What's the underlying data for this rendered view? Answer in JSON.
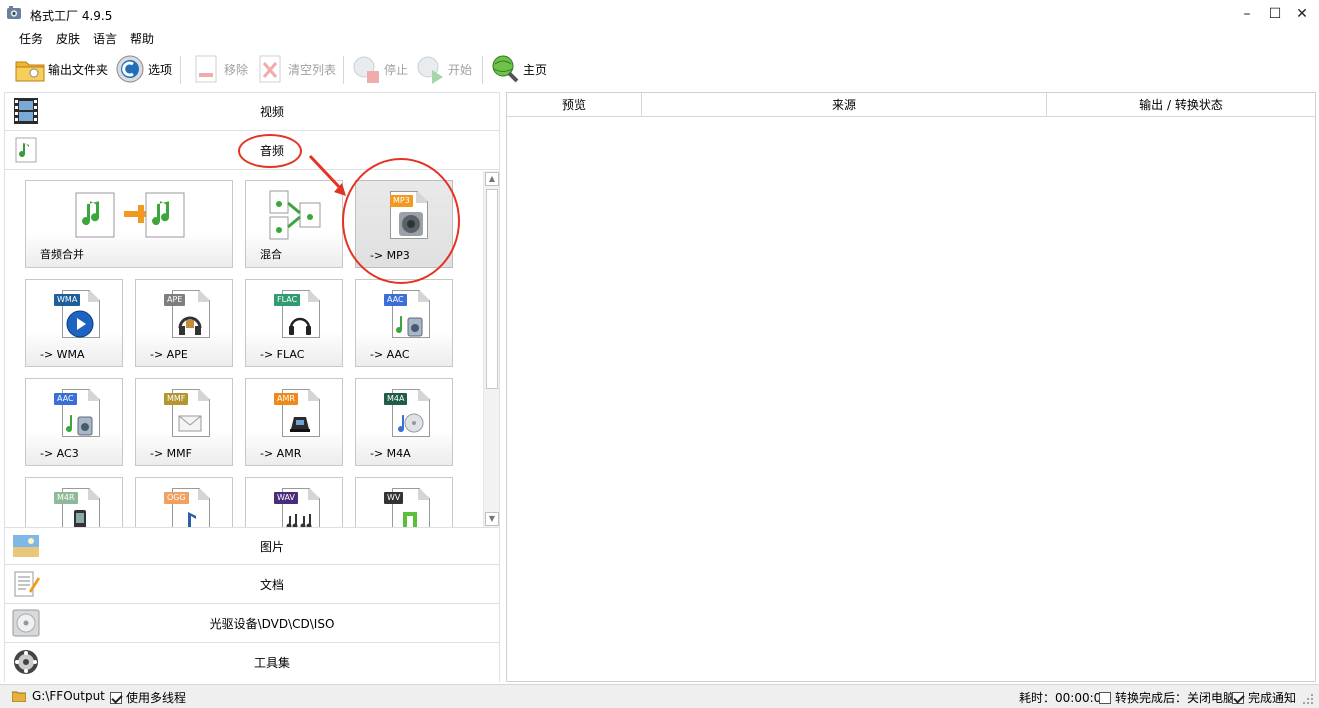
{
  "window": {
    "title": "格式工厂 4.9.5",
    "minimize": "–",
    "maximize": "☐",
    "close": "✕"
  },
  "menu": [
    "任务",
    "皮肤",
    "语言",
    "帮助"
  ],
  "toolbar": {
    "output_folder": "输出文件夹",
    "options": "选项",
    "remove": "移除",
    "clear_list": "清空列表",
    "stop": "停止",
    "start": "开始",
    "home": "主页"
  },
  "categories": {
    "video": "视频",
    "audio": "音频",
    "image": "图片",
    "document": "文档",
    "disc": "光驱设备\\DVD\\CD\\ISO",
    "tools": "工具集"
  },
  "audio_tiles": [
    {
      "label": "音频合并",
      "icon": "audio-merge-icon"
    },
    {
      "label": "混合",
      "icon": "audio-mix-icon"
    },
    {
      "label": "-> MP3",
      "badge": "MP3",
      "badge_color": "#f29a1f",
      "icon": "speaker-icon"
    },
    {
      "label": "-> WMA",
      "badge": "WMA",
      "badge_color": "#1d5f99",
      "icon": "play-icon"
    },
    {
      "label": "-> APE",
      "badge": "APE",
      "badge_color": "#7e7e7e",
      "icon": "headphones-icon"
    },
    {
      "label": "-> FLAC",
      "badge": "FLAC",
      "badge_color": "#2f9b6f",
      "icon": "headset-icon"
    },
    {
      "label": "-> AAC",
      "badge": "AAC",
      "badge_color": "#3a6fd8",
      "icon": "music-speaker-icon"
    },
    {
      "label": "-> AC3",
      "badge": "AAC",
      "badge_color": "#3a6fd8",
      "icon": "music-speaker-icon"
    },
    {
      "label": "-> MMF",
      "badge": "MMF",
      "badge_color": "#b3962e",
      "icon": "mail-icon"
    },
    {
      "label": "-> AMR",
      "badge": "AMR",
      "badge_color": "#f0891c",
      "icon": "phone-icon"
    },
    {
      "label": "-> M4A",
      "badge": "M4A",
      "badge_color": "#1f5c4a",
      "icon": "music-disc-icon"
    },
    {
      "label": "",
      "badge": "M4R",
      "badge_color": "#8fba9a",
      "icon": "mobile-icon"
    },
    {
      "label": "",
      "badge": "OGG",
      "badge_color": "#f0a060",
      "icon": "note-icon"
    },
    {
      "label": "",
      "badge": "WAV",
      "badge_color": "#4a2d7a",
      "icon": "notes-icon"
    },
    {
      "label": "",
      "badge": "WV",
      "badge_color": "#333333",
      "icon": "green-note-icon"
    }
  ],
  "table": {
    "columns": [
      "预览",
      "来源",
      "输出 / 转换状态"
    ]
  },
  "status": {
    "output_path": "G:\\FFOutput",
    "multithread": "使用多线程",
    "elapsed": "耗时：00:00:00",
    "after_convert": "转换完成后：关闭电脑",
    "notify": "完成通知"
  },
  "colors": {
    "accent_red": "#e53222",
    "statusbar_bg": "#efefef"
  }
}
